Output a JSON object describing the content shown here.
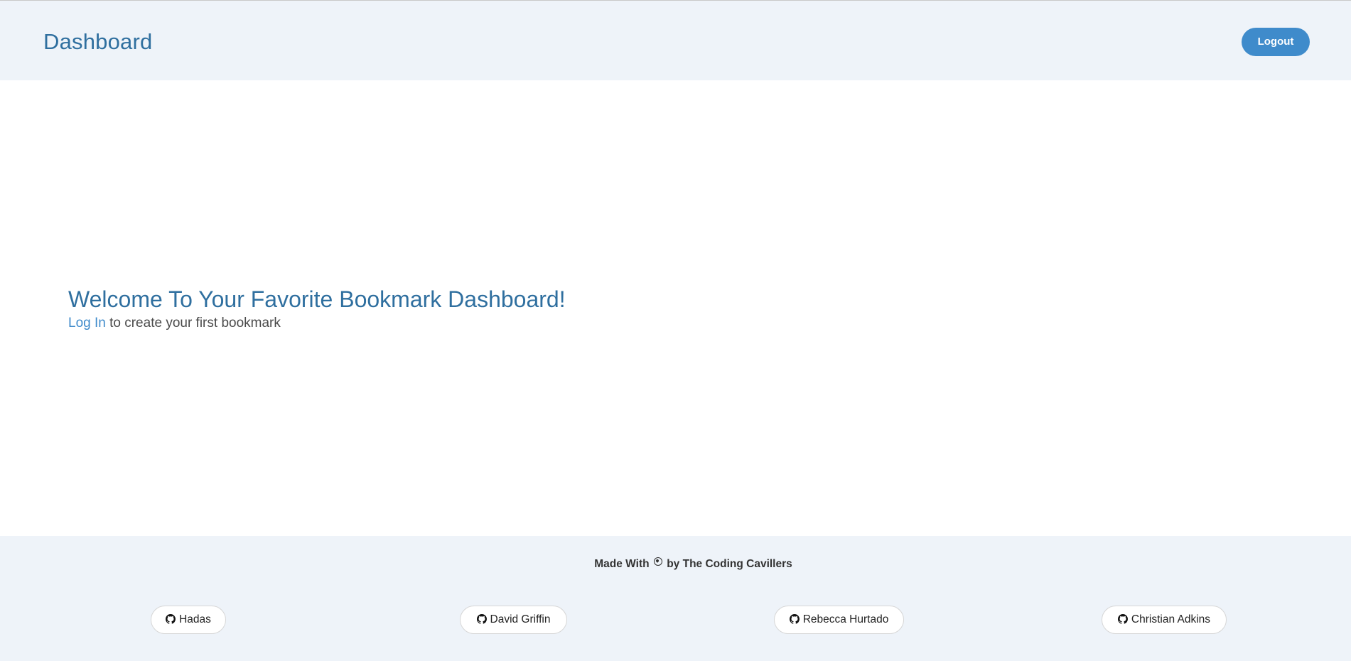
{
  "header": {
    "title": "Dashboard",
    "logout_label": "Logout"
  },
  "main": {
    "welcome_title": "Welcome To Your Favorite Bookmark Dashboard!",
    "login_link": "Log In",
    "welcome_rest": " to create your first bookmark"
  },
  "footer": {
    "made_with_prefix": "Made With",
    "made_with_suffix": "by The Coding Cavillers",
    "heart_icon": "heart-icon",
    "contributors": [
      {
        "name": "Hadas",
        "icon": "github-icon"
      },
      {
        "name": "David Griffin",
        "icon": "github-icon"
      },
      {
        "name": "Rebecca Hurtado",
        "icon": "github-icon"
      },
      {
        "name": "Christian Adkins",
        "icon": "github-icon"
      }
    ]
  },
  "colors": {
    "accent": "#3f8bcb",
    "title": "#2f6f9f",
    "band_background": "#eef3f9"
  }
}
